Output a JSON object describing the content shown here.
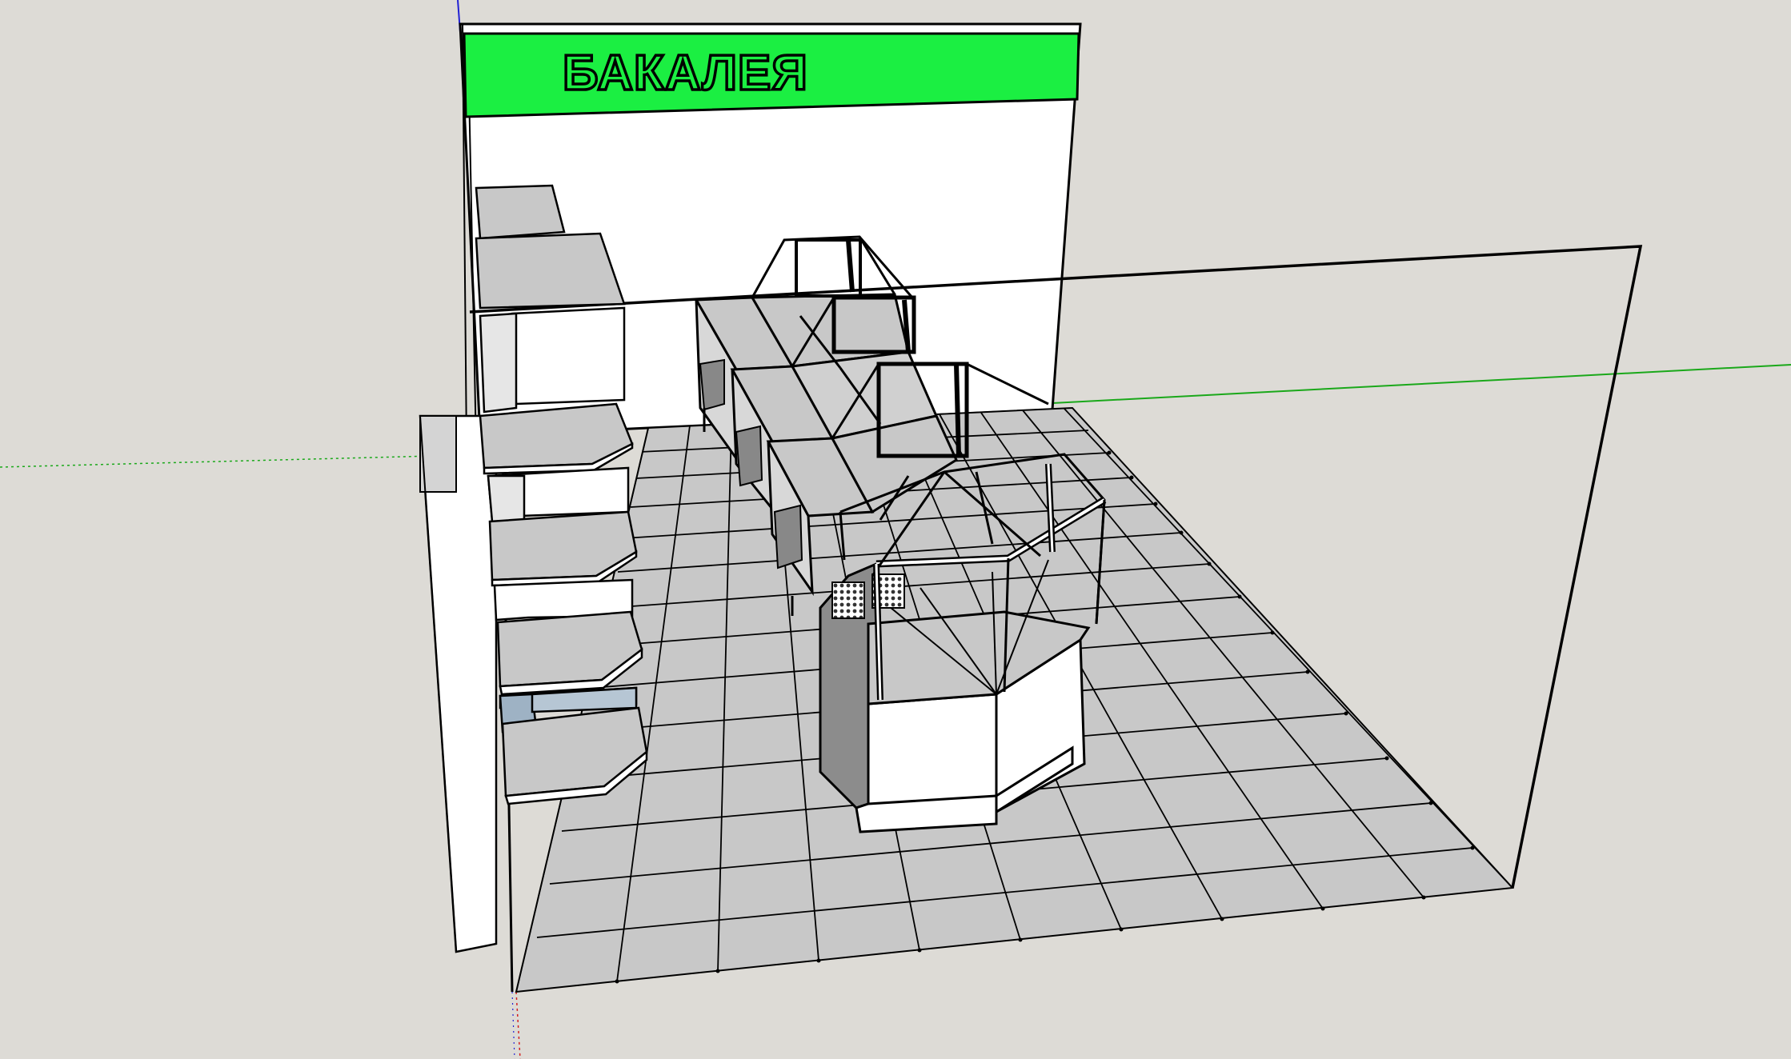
{
  "sign": {
    "text": "БАКАЛЕЯ",
    "color": "#1bef42"
  },
  "viewport": {
    "background": "#dddbd6",
    "floor_tile_color": "#c8c8c8",
    "wall_color": "#ffffff",
    "axis_colors": {
      "red": "#d42020",
      "green": "#1aa81a",
      "blue": "#2020d4"
    }
  }
}
